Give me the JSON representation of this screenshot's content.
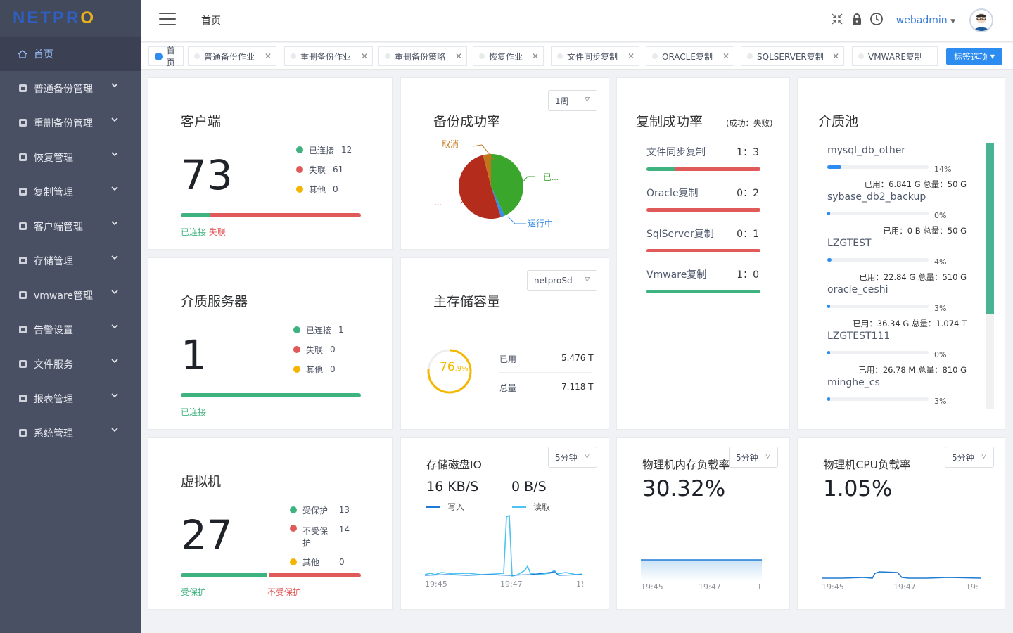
{
  "logo": {
    "text": "NETPR",
    "accent": "O"
  },
  "sidebar": {
    "items": [
      {
        "label": "首页",
        "icon": "home-icon"
      },
      {
        "label": "普通备份管理",
        "icon": "database-icon"
      },
      {
        "label": "重删备份管理",
        "icon": "layers-icon"
      },
      {
        "label": "恢复管理",
        "icon": "restore-icon"
      },
      {
        "label": "复制管理",
        "icon": "copy-icon"
      },
      {
        "label": "客户端管理",
        "icon": "client-icon"
      },
      {
        "label": "存储管理",
        "icon": "storage-icon"
      },
      {
        "label": "vmware管理",
        "icon": "vmware-icon"
      },
      {
        "label": "告警设置",
        "icon": "alarm-icon"
      },
      {
        "label": "文件服务",
        "icon": "file-service-icon"
      },
      {
        "label": "报表管理",
        "icon": "chart-icon"
      },
      {
        "label": "系统管理",
        "icon": "settings-icon"
      }
    ]
  },
  "header": {
    "breadcrumb": "首页",
    "user": "webadmin"
  },
  "tabs": {
    "items": [
      "首页",
      "普通备份作业",
      "重删备份作业",
      "重删备份策略",
      "恢复作业",
      "文件同步复制",
      "ORACLE复制",
      "SQLSERVER复制",
      "VMWARE复制"
    ],
    "options_label": "标签选项"
  },
  "clients": {
    "title": "客户端",
    "count": "73",
    "legend": [
      {
        "label": "已连接",
        "value": "12",
        "color": "#3fb37f"
      },
      {
        "label": "失联",
        "value": "61",
        "color": "#e05a5a"
      },
      {
        "label": "其他",
        "value": "0",
        "color": "#f5b400"
      }
    ],
    "connected_fraction": 0.164,
    "bar_label_connected": "已连接",
    "bar_label_lost": "失联"
  },
  "backup_rate": {
    "title": "备份成功率",
    "period": "1周",
    "pie_labels": {
      "cancel": "取消",
      "success": "已...",
      "running": "运行中",
      "failed": "..."
    },
    "slices": [
      {
        "name": "success",
        "value": 0.43,
        "color": "#3aa62c"
      },
      {
        "name": "failed",
        "value": 0.51,
        "color": "#b42c1b"
      },
      {
        "name": "cancel",
        "value": 0.04,
        "color": "#c2761c"
      },
      {
        "name": "running",
        "value": 0.02,
        "color": "#3a8ee6"
      }
    ]
  },
  "replication": {
    "title": "复制成功率",
    "subtitle": "(成功：失败)",
    "items": [
      {
        "label": "文件同步复制",
        "ratio": "1：3",
        "success": 1,
        "fail": 3
      },
      {
        "label": "Oracle复制",
        "ratio": "0：2",
        "success": 0,
        "fail": 2
      },
      {
        "label": "SqlServer复制",
        "ratio": "0：1",
        "success": 0,
        "fail": 1
      },
      {
        "label": "Vmware复制",
        "ratio": "1：0",
        "success": 1,
        "fail": 0
      }
    ]
  },
  "media_pool": {
    "title": "介质池",
    "items": [
      {
        "name": "mysql_db_other",
        "percent": "14%",
        "pct": 0.14,
        "used": "已用：6.841 G 总量：50 G"
      },
      {
        "name": "sybase_db2_backup",
        "percent": "0%",
        "pct": 0,
        "used": "已用：0 B 总量：50 G"
      },
      {
        "name": "LZGTEST",
        "percent": "4%",
        "pct": 0.04,
        "used": "已用：22.84 G 总量：510 G"
      },
      {
        "name": "oracle_ceshi",
        "percent": "3%",
        "pct": 0.03,
        "used": "已用：36.34 G 总量：1.074 T"
      },
      {
        "name": "LZGTEST111",
        "percent": "0%",
        "pct": 0,
        "used": "已用：26.78 M 总量：810 G"
      },
      {
        "name": "minghe_cs",
        "percent": "3%",
        "pct": 0.03,
        "used": ""
      }
    ]
  },
  "media_server": {
    "title": "介质服务器",
    "count": "1",
    "legend": [
      {
        "label": "已连接",
        "value": "1",
        "color": "#3fb37f"
      },
      {
        "label": "失联",
        "value": "0",
        "color": "#e05a5a"
      },
      {
        "label": "其他",
        "value": "0",
        "color": "#f5b400"
      }
    ],
    "bar_label": "已连接"
  },
  "storage": {
    "title": "主存储容量",
    "selector": "netproSd",
    "percent_main": "76",
    "percent_sub": ".9%",
    "pct": 0.769,
    "used_label": "已用",
    "used_value": "5.476 T",
    "total_label": "总量",
    "total_value": "7.118 T"
  },
  "vm": {
    "title": "虚拟机",
    "count": "27",
    "legend": [
      {
        "label": "受保护",
        "value": "13",
        "color": "#3fb37f"
      },
      {
        "label": "不受保护",
        "value": "14",
        "color": "#e05a5a"
      },
      {
        "label": "其他",
        "value": "0",
        "color": "#f5b400"
      }
    ],
    "protected_fraction": 0.481,
    "bar_label_protected": "受保护",
    "bar_label_unprotected": "不受保护"
  },
  "disk_io": {
    "title": "存储磁盘IO",
    "period": "5分钟",
    "write_value": "16 KB/S",
    "write_label": "写入",
    "read_value": "0 B/S",
    "read_label": "读取",
    "ticks": [
      "19:45",
      "19:47",
      "1!"
    ]
  },
  "mem": {
    "title": "物理机内存负载率",
    "period": "5分钟",
    "value": "30.32%",
    "ticks": [
      "19:45",
      "19:47",
      "1"
    ]
  },
  "cpu": {
    "title": "物理机CPU负载率",
    "period": "5分钟",
    "value": "1.05%",
    "ticks": [
      "19:45",
      "19:47",
      "19:"
    ]
  }
}
